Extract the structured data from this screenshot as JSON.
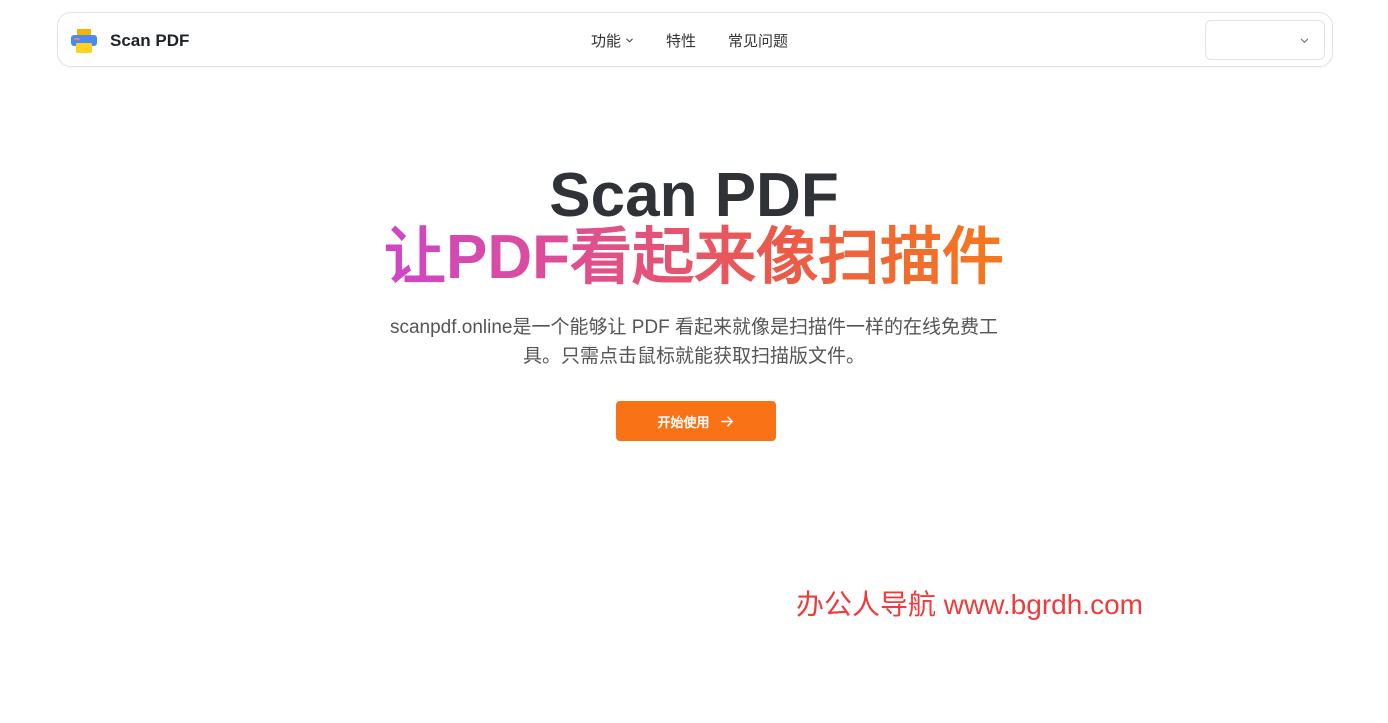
{
  "header": {
    "brand_name": "Scan PDF",
    "nav": [
      {
        "label": "功能",
        "has_dropdown": true
      },
      {
        "label": "特性"
      },
      {
        "label": "常见问题"
      }
    ],
    "language_select": {
      "value": ""
    }
  },
  "hero": {
    "title": "Scan PDF",
    "subtitle": "让PDF看起来像扫描件",
    "description": "scanpdf.online是一个能够让 PDF 看起来就像是扫描件一样的在线免费工具。只需点击鼠标就能获取扫描版文件。",
    "cta_label": "开始使用"
  },
  "watermark": "办公人导航 www.bgrdh.com",
  "colors": {
    "accent": "#f97316",
    "gradient_start": "#cf45c8",
    "gradient_end": "#f57a1c",
    "watermark": "#ef3b3b"
  },
  "icons": {
    "logo": "printer-logo-icon",
    "nav_dropdown": "chevron-down-icon",
    "select": "chevron-down-icon",
    "cta": "arrow-right-icon"
  }
}
